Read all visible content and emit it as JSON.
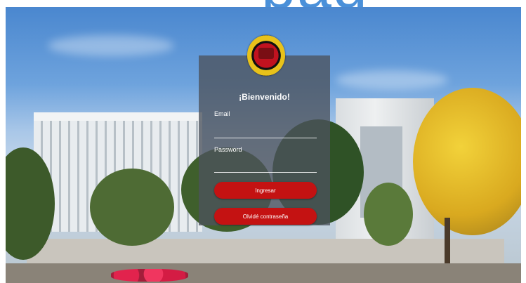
{
  "header": {
    "partial_text": "pág"
  },
  "login": {
    "title": "¡Bienvenido!",
    "email_label": "Email",
    "email_value": "",
    "password_label": "Password",
    "password_value": "",
    "login_button": "Ingresar",
    "forgot_button": "Olvidé contraseña"
  },
  "colors": {
    "panel": "#4b525c",
    "button": "#c41212",
    "header_text": "#4a90d9"
  }
}
